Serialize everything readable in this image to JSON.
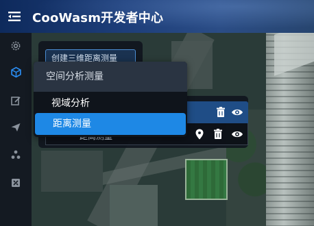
{
  "header": {
    "title": "CooWasm开发者中心",
    "menu_icon": "menu-toggle-icon"
  },
  "sidebar": {
    "items": [
      {
        "icon": "gear-icon",
        "active": false
      },
      {
        "icon": "cube-icon",
        "active": true
      },
      {
        "icon": "edit-icon",
        "active": false
      },
      {
        "icon": "send-icon",
        "active": false
      },
      {
        "icon": "nodes-icon",
        "active": false
      },
      {
        "icon": "tools-icon",
        "active": false
      }
    ]
  },
  "panel": {
    "button_label": "创建三维距离测量"
  },
  "list": {
    "rows": [
      {
        "label": "",
        "selected": true
      },
      {
        "label": "距离测量",
        "selected": false
      }
    ]
  },
  "dropdown": {
    "header": "空间分析测量",
    "items": [
      {
        "label": "视域分析",
        "selected": false
      },
      {
        "label": "距离测量",
        "selected": true
      }
    ]
  },
  "colors": {
    "accent": "#1e88e5",
    "sidebar_bg": "#141a22",
    "active_icon": "#2a8cf0"
  }
}
